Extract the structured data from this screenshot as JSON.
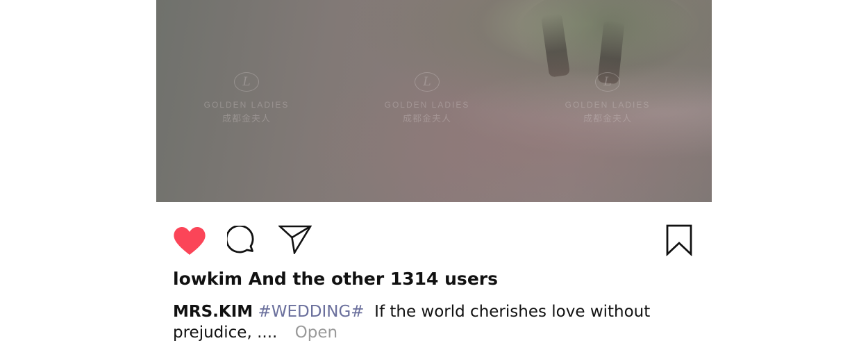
{
  "post": {
    "watermark": {
      "monogram": "L",
      "brand": "GOLDEN LADIES",
      "sub": "成都金夫人"
    },
    "actions": {
      "like_icon": "heart-icon",
      "comment_icon": "comment-icon",
      "share_icon": "send-icon",
      "save_icon": "bookmark-icon",
      "liked": true,
      "like_color": "#fb4558"
    },
    "likes_text": "lowkim And the other 1314 users",
    "caption": {
      "username": "MRS.KIM",
      "hashtag": "#WEDDING#",
      "text": "If the world cherishes love without prejudice, ....",
      "more_label": "Open"
    }
  }
}
